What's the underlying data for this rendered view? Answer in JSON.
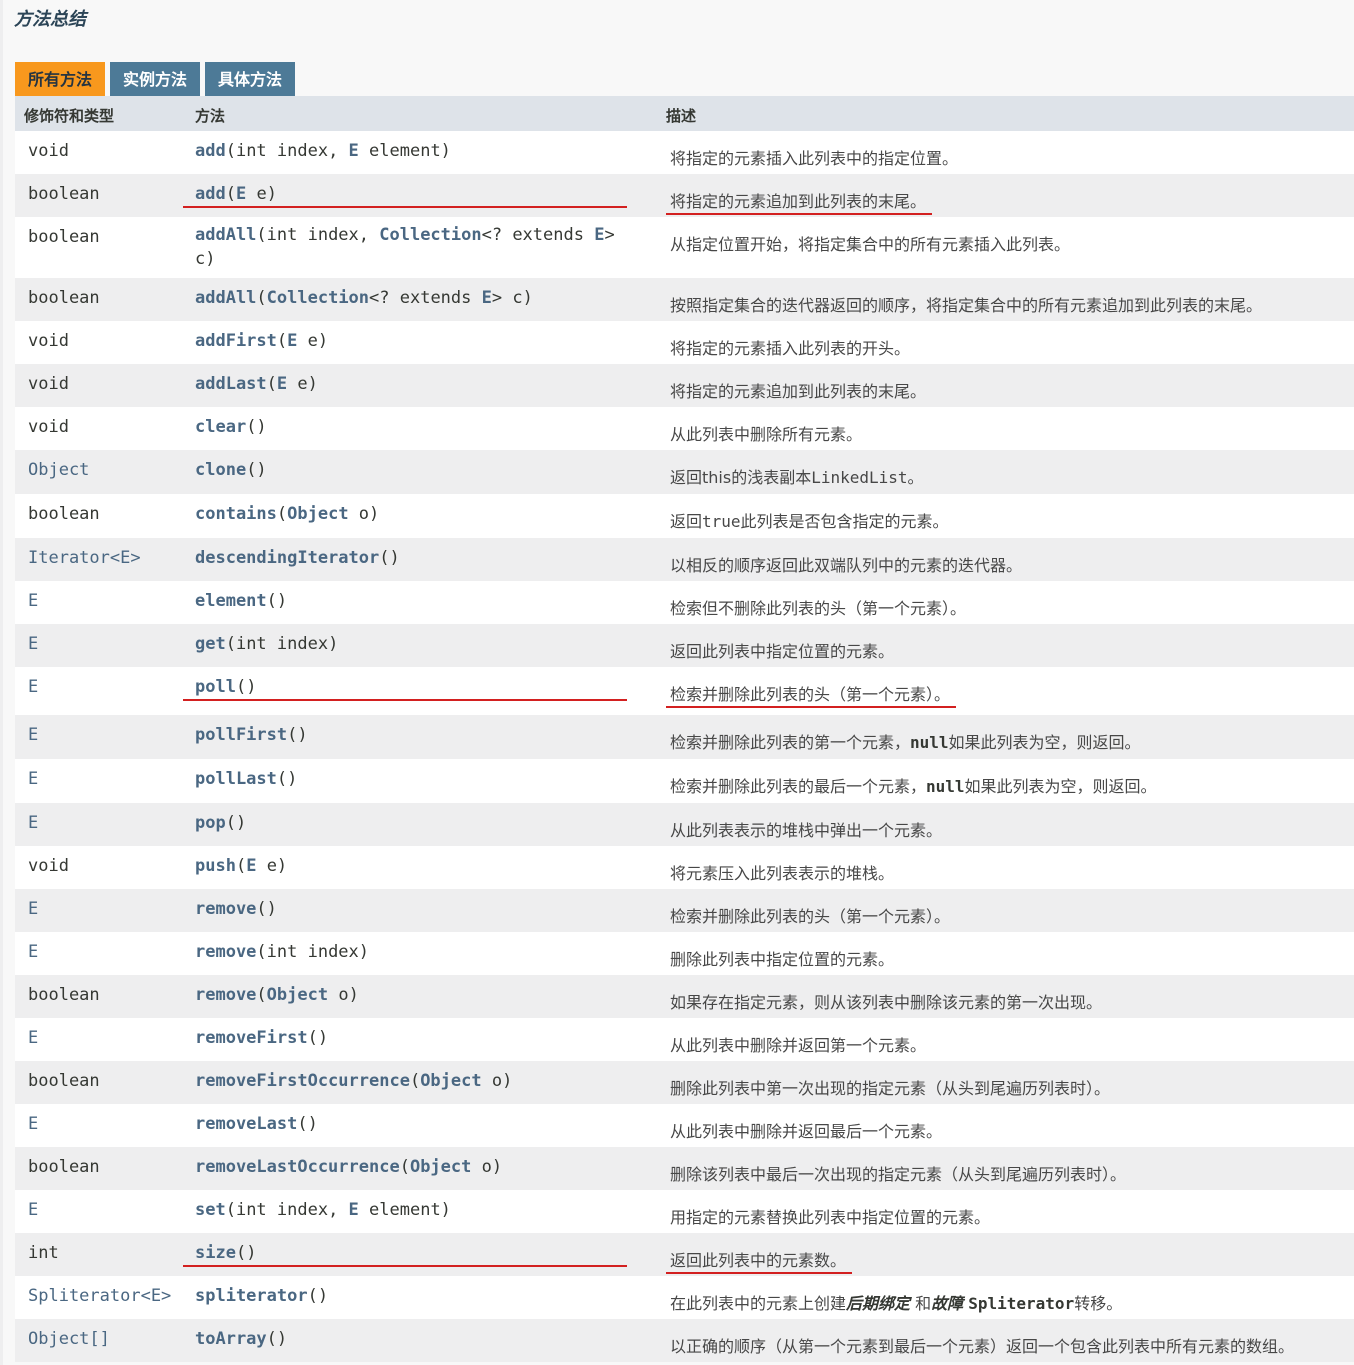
{
  "section_title": "方法总结",
  "tabs": [
    {
      "label": "所有方法",
      "active": true
    },
    {
      "label": "实例方法",
      "active": false
    },
    {
      "label": "具体方法",
      "active": false
    }
  ],
  "header": {
    "modifier": "修饰符和类型",
    "method": "方法",
    "description": "描述"
  },
  "colors": {
    "tab_active": "#f8981d",
    "tab_inactive": "#4d7a97",
    "header_bg": "#dee3e9",
    "link": "#4a6782",
    "highlight_underline": "#d32020"
  },
  "rows": [
    {
      "type": "void",
      "type_link": false,
      "name": "add",
      "params": [
        {
          "t": "(int index, "
        },
        {
          "t": "E",
          "link": true
        },
        {
          "t": " element)"
        }
      ],
      "desc": "将指定的元素插入此列表中的指定位置。",
      "highlight": false
    },
    {
      "type": "boolean",
      "type_link": false,
      "name": "add",
      "params": [
        {
          "t": "("
        },
        {
          "t": "E",
          "link": true
        },
        {
          "t": " e)"
        }
      ],
      "desc": "将指定的元素追加到此列表的末尾。",
      "highlight": true
    },
    {
      "type": "boolean",
      "type_link": false,
      "name": "addAll",
      "params": [
        {
          "t": "(int index, "
        },
        {
          "t": "Collection",
          "link": true
        },
        {
          "t": "<? extends "
        },
        {
          "t": "E",
          "link": true
        },
        {
          "t": "> c)"
        }
      ],
      "desc": "从指定位置开始，将指定集合中的所有元素插入此列表。",
      "highlight": false
    },
    {
      "type": "boolean",
      "type_link": false,
      "name": "addAll",
      "params": [
        {
          "t": "("
        },
        {
          "t": "Collection",
          "link": true
        },
        {
          "t": "<? extends "
        },
        {
          "t": "E",
          "link": true
        },
        {
          "t": "> c)"
        }
      ],
      "desc": "按照指定集合的迭代器返回的顺序，将指定集合中的所有元素追加到此列表的末尾。",
      "highlight": false
    },
    {
      "type": "void",
      "type_link": false,
      "name": "addFirst",
      "params": [
        {
          "t": "("
        },
        {
          "t": "E",
          "link": true
        },
        {
          "t": " e)"
        }
      ],
      "desc": "将指定的元素插入此列表的开头。",
      "highlight": false
    },
    {
      "type": "void",
      "type_link": false,
      "name": "addLast",
      "params": [
        {
          "t": "("
        },
        {
          "t": "E",
          "link": true
        },
        {
          "t": " e)"
        }
      ],
      "desc": "将指定的元素追加到此列表的末尾。",
      "highlight": false
    },
    {
      "type": "void",
      "type_link": false,
      "name": "clear",
      "params": [
        {
          "t": "()"
        }
      ],
      "desc": "从此列表中删除所有元素。",
      "highlight": false
    },
    {
      "type": "Object",
      "type_link": true,
      "name": "clone",
      "params": [
        {
          "t": "()"
        }
      ],
      "desc_parts": [
        {
          "t": "返回this的浅表副本"
        },
        {
          "t": "LinkedList",
          "code": "light"
        },
        {
          "t": "。"
        }
      ],
      "highlight": false
    },
    {
      "type": "boolean",
      "type_link": false,
      "name": "contains",
      "params": [
        {
          "t": "("
        },
        {
          "t": "Object",
          "link": true
        },
        {
          "t": " o)"
        }
      ],
      "desc_parts": [
        {
          "t": "返回"
        },
        {
          "t": "true",
          "code": "light"
        },
        {
          "t": "此列表是否包含指定的元素。"
        }
      ],
      "highlight": false
    },
    {
      "type": "Iterator<E>",
      "type_link": true,
      "name": "descendingIterator",
      "params": [
        {
          "t": "()"
        }
      ],
      "desc": "以相反的顺序返回此双端队列中的元素的迭代器。",
      "highlight": false
    },
    {
      "type": "E",
      "type_link": true,
      "name": "element",
      "params": [
        {
          "t": "()"
        }
      ],
      "desc": "检索但不删除此列表的头（第一个元素）。",
      "highlight": false
    },
    {
      "type": "E",
      "type_link": true,
      "name": "get",
      "params": [
        {
          "t": "(int index)"
        }
      ],
      "desc": "返回此列表中指定位置的元素。",
      "highlight": false
    },
    {
      "type": "E",
      "type_link": true,
      "name": "poll",
      "params": [
        {
          "t": "()"
        }
      ],
      "desc": "检索并删除此列表的头（第一个元素）。",
      "highlight": true
    },
    {
      "type": "E",
      "type_link": true,
      "name": "pollFirst",
      "params": [
        {
          "t": "()"
        }
      ],
      "desc_parts": [
        {
          "t": "检索并删除此列表的第一个元素，"
        },
        {
          "t": "null",
          "code": "bold"
        },
        {
          "t": "如果此列表为空，则返回。"
        }
      ],
      "highlight": false
    },
    {
      "type": "E",
      "type_link": true,
      "name": "pollLast",
      "params": [
        {
          "t": "()"
        }
      ],
      "desc_parts": [
        {
          "t": "检索并删除此列表的最后一个元素，"
        },
        {
          "t": "null",
          "code": "bold"
        },
        {
          "t": "如果此列表为空，则返回。"
        }
      ],
      "highlight": false
    },
    {
      "type": "E",
      "type_link": true,
      "name": "pop",
      "params": [
        {
          "t": "()"
        }
      ],
      "desc": "从此列表表示的堆栈中弹出一个元素。",
      "highlight": false
    },
    {
      "type": "void",
      "type_link": false,
      "name": "push",
      "params": [
        {
          "t": "("
        },
        {
          "t": "E",
          "link": true
        },
        {
          "t": " e)"
        }
      ],
      "desc": "将元素压入此列表表示的堆栈。",
      "highlight": false
    },
    {
      "type": "E",
      "type_link": true,
      "name": "remove",
      "params": [
        {
          "t": "()"
        }
      ],
      "desc": "检索并删除此列表的头（第一个元素）。",
      "highlight": false
    },
    {
      "type": "E",
      "type_link": true,
      "name": "remove",
      "params": [
        {
          "t": "(int index)"
        }
      ],
      "desc": "删除此列表中指定位置的元素。",
      "highlight": false
    },
    {
      "type": "boolean",
      "type_link": false,
      "name": "remove",
      "params": [
        {
          "t": "("
        },
        {
          "t": "Object",
          "link": true
        },
        {
          "t": " o)"
        }
      ],
      "desc": "如果存在指定元素，则从该列表中删除该元素的第一次出现。",
      "highlight": false
    },
    {
      "type": "E",
      "type_link": true,
      "name": "removeFirst",
      "params": [
        {
          "t": "()"
        }
      ],
      "desc": "从此列表中删除并返回第一个元素。",
      "highlight": false
    },
    {
      "type": "boolean",
      "type_link": false,
      "name": "removeFirstOccurrence",
      "params": [
        {
          "t": "("
        },
        {
          "t": "Object",
          "link": true
        },
        {
          "t": " o)"
        }
      ],
      "desc": "删除此列表中第一次出现的指定元素（从头到尾遍历列表时）。",
      "highlight": false
    },
    {
      "type": "E",
      "type_link": true,
      "name": "removeLast",
      "params": [
        {
          "t": "()"
        }
      ],
      "desc": "从此列表中删除并返回最后一个元素。",
      "highlight": false
    },
    {
      "type": "boolean",
      "type_link": false,
      "name": "removeLastOccurrence",
      "params": [
        {
          "t": "("
        },
        {
          "t": "Object",
          "link": true
        },
        {
          "t": " o)"
        }
      ],
      "desc": "删除该列表中最后一次出现的指定元素（从头到尾遍历列表时）。",
      "highlight": false
    },
    {
      "type": "E",
      "type_link": true,
      "name": "set",
      "params": [
        {
          "t": "(int index, "
        },
        {
          "t": "E",
          "link": true
        },
        {
          "t": " element)"
        }
      ],
      "desc": "用指定的元素替换此列表中指定位置的元素。",
      "highlight": false
    },
    {
      "type": "int",
      "type_link": false,
      "name": "size",
      "params": [
        {
          "t": "()"
        }
      ],
      "desc": "返回此列表中的元素数。",
      "highlight": true
    },
    {
      "type": "Spliterator<E>",
      "type_link": true,
      "name": "spliterator",
      "params": [
        {
          "t": "()"
        }
      ],
      "desc_parts": [
        {
          "t": "在此列表中的元素上创建"
        },
        {
          "t": "后期绑定",
          "em": true
        },
        {
          "t": " 和"
        },
        {
          "t": "故障",
          "em2": true
        },
        {
          "t": " "
        },
        {
          "t": "Spliterator",
          "code": "bold"
        },
        {
          "t": "转移。"
        }
      ],
      "highlight": false
    },
    {
      "type": "Object[]",
      "type_link": true,
      "name": "toArray",
      "params": [
        {
          "t": "()"
        }
      ],
      "desc": "以正确的顺序（从第一个元素到最后一个元素）返回一个包含此列表中所有元素的数组。",
      "highlight": false
    }
  ]
}
